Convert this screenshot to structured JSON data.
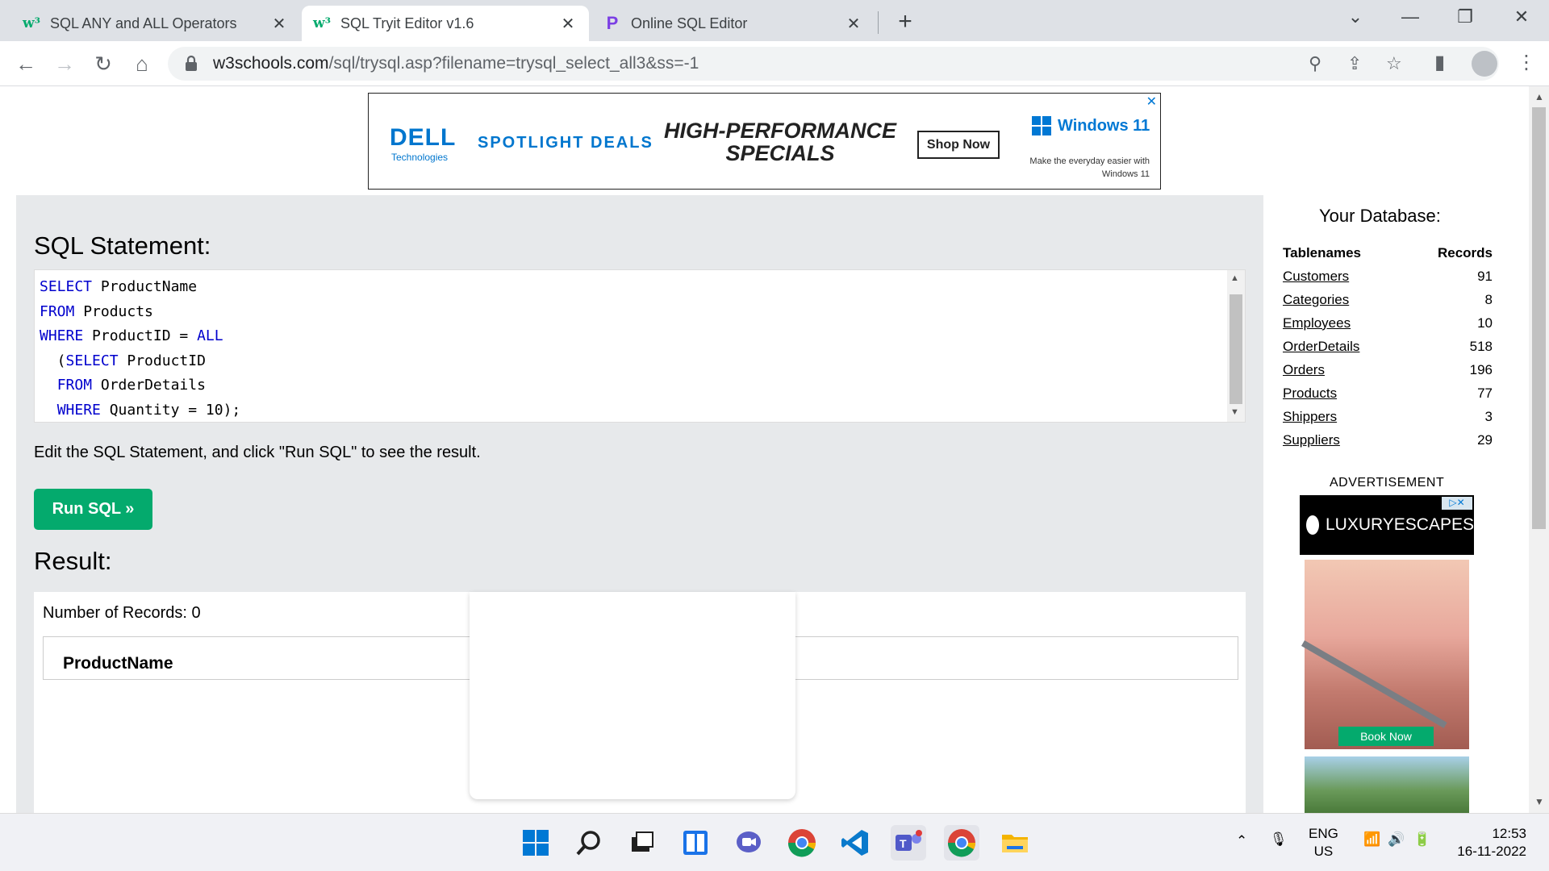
{
  "browser": {
    "tabs": [
      {
        "title": "SQL ANY and ALL Operators",
        "favicon": "w3schools-icon"
      },
      {
        "title": "SQL Tryit Editor v1.6",
        "favicon": "w3schools-icon"
      },
      {
        "title": "Online SQL Editor",
        "favicon": "programiz-icon"
      }
    ],
    "url_domain": "w3schools.com",
    "url_path": "/sql/trysql.asp?filename=trysql_select_all3&ss=-1"
  },
  "ad_banner": {
    "brand": "DELL",
    "brand_sub": "Technologies",
    "spotlight": "SPOTLIGHT DEALS",
    "headline": "HIGH-PERFORMANCE SPECIALS",
    "shop_now": "Shop Now",
    "windows": "Windows 11",
    "tagline": "Make the everyday easier with Windows 11"
  },
  "editor": {
    "heading": "SQL Statement:",
    "code_lines": [
      [
        {
          "kw": "SELECT"
        },
        {
          "t": " ProductName"
        }
      ],
      [
        {
          "kw": "FROM"
        },
        {
          "t": " Products"
        }
      ],
      [
        {
          "kw": "WHERE"
        },
        {
          "t": " ProductID = "
        },
        {
          "kw": "ALL"
        }
      ],
      [
        {
          "t": "  ("
        },
        {
          "kw": "SELECT"
        },
        {
          "t": " ProductID"
        }
      ],
      [
        {
          "t": "  "
        },
        {
          "kw": "FROM"
        },
        {
          "t": " OrderDetails"
        }
      ],
      [
        {
          "t": "  "
        },
        {
          "kw": "WHERE"
        },
        {
          "t": " Quantity = 10);"
        }
      ]
    ],
    "instruction": "Edit the SQL Statement, and click \"Run SQL\" to see the result.",
    "run_button": "Run SQL »"
  },
  "result": {
    "heading": "Result:",
    "records": "Number of Records: 0",
    "columns": [
      "ProductName"
    ]
  },
  "database": {
    "title": "Your Database:",
    "col_table": "Tablenames",
    "col_records": "Records",
    "tables": [
      {
        "name": "Customers",
        "records": "91"
      },
      {
        "name": "Categories",
        "records": "8"
      },
      {
        "name": "Employees",
        "records": "10"
      },
      {
        "name": "OrderDetails",
        "records": "518"
      },
      {
        "name": "Orders",
        "records": "196"
      },
      {
        "name": "Products",
        "records": "77"
      },
      {
        "name": "Shippers",
        "records": "3"
      },
      {
        "name": "Suppliers",
        "records": "29"
      }
    ]
  },
  "advertisement": {
    "label": "ADVERTISEMENT",
    "brand": "LUXURYESCAPES",
    "book_now": "Book Now"
  },
  "taskbar": {
    "lang_top": "ENG",
    "lang_bottom": "US",
    "time": "12:53",
    "date": "16-11-2022"
  }
}
